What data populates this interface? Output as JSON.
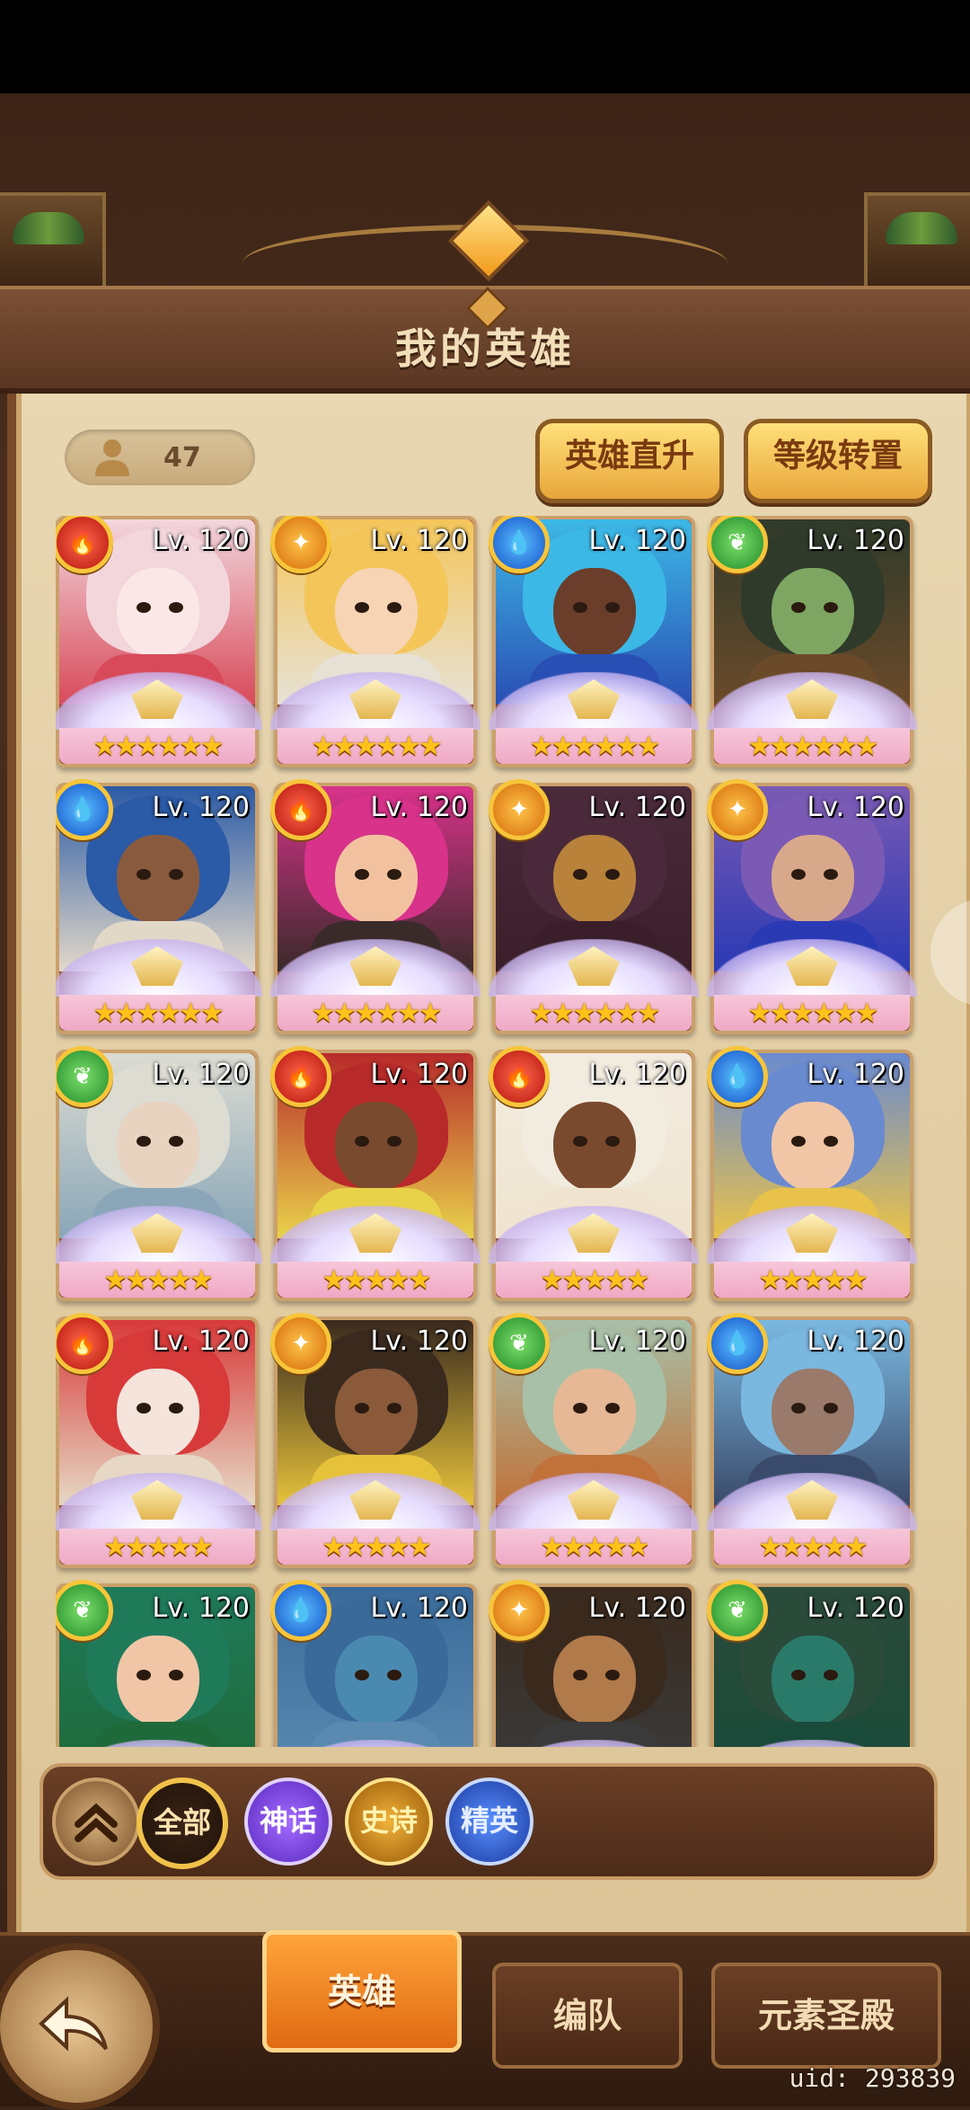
{
  "header": {
    "title": "我的英雄"
  },
  "hero_count": "47",
  "top_buttons": {
    "direct_upgrade": "英雄直升",
    "level_transfer": "等级转置"
  },
  "heroes": [
    {
      "level": "Lv. 120",
      "element": "fire",
      "stars": "★★★★★★",
      "colors": [
        "#f2d6dc",
        "#fbe8e6",
        "#d84a5a"
      ]
    },
    {
      "level": "Lv. 120",
      "element": "light",
      "stars": "★★★★★★",
      "colors": [
        "#f4c65a",
        "#f6d4b4",
        "#e7e1d5"
      ]
    },
    {
      "level": "Lv. 120",
      "element": "water",
      "stars": "★★★★★★",
      "colors": [
        "#3cb8e6",
        "#6b3e2c",
        "#2a4fb4"
      ]
    },
    {
      "level": "Lv. 120",
      "element": "nature",
      "stars": "★★★★★★",
      "colors": [
        "#2f3a2a",
        "#7ea662",
        "#6b4a2a"
      ]
    },
    {
      "level": "Lv. 120",
      "element": "water",
      "stars": "★★★★★★",
      "colors": [
        "#2b5aa6",
        "#8a5a3e",
        "#e2d8c8"
      ]
    },
    {
      "level": "Lv. 120",
      "element": "fire",
      "stars": "★★★★★★",
      "colors": [
        "#d8328a",
        "#f2c2a0",
        "#3a2a2a"
      ]
    },
    {
      "level": "Lv. 120",
      "element": "light",
      "stars": "★★★★★★",
      "colors": [
        "#4a2a3a",
        "#b8823a",
        "#3a1f2a"
      ]
    },
    {
      "level": "Lv. 120",
      "element": "light",
      "stars": "★★★★★★",
      "colors": [
        "#7a5ab4",
        "#d8a88a",
        "#2a3ab4"
      ]
    },
    {
      "level": "Lv. 120",
      "element": "nature",
      "stars": "★★★★★",
      "colors": [
        "#dcdcd2",
        "#e8d2c0",
        "#8aa6b8"
      ]
    },
    {
      "level": "Lv. 120",
      "element": "fire",
      "stars": "★★★★★",
      "colors": [
        "#b82a2a",
        "#7a4a2e",
        "#e8d24a"
      ]
    },
    {
      "level": "Lv. 120",
      "element": "fire",
      "stars": "★★★★★",
      "colors": [
        "#f2ece0",
        "#7a4a2e",
        "#f0e4d0"
      ]
    },
    {
      "level": "Lv. 120",
      "element": "water",
      "stars": "★★★★★",
      "colors": [
        "#6a8ad0",
        "#f0c6a6",
        "#e8c24a"
      ]
    },
    {
      "level": "Lv. 120",
      "element": "fire",
      "stars": "★★★★★",
      "colors": [
        "#d83a3a",
        "#f4e4dc",
        "#e6d8c4"
      ]
    },
    {
      "level": "Lv. 120",
      "element": "light",
      "stars": "★★★★★",
      "colors": [
        "#3a2a1e",
        "#8a5a3a",
        "#e6c23a"
      ]
    },
    {
      "level": "Lv. 120",
      "element": "nature",
      "stars": "★★★★★",
      "colors": [
        "#a8c0a8",
        "#e6b896",
        "#c0723a"
      ]
    },
    {
      "level": "Lv. 120",
      "element": "water",
      "stars": "★★★★★",
      "colors": [
        "#7ab8e0",
        "#9a7a6a",
        "#3a4a6a"
      ]
    },
    {
      "level": "Lv. 120",
      "element": "nature",
      "stars": "",
      "colors": [
        "#1f7a5a",
        "#f0c6a6",
        "#1f6a3a"
      ]
    },
    {
      "level": "Lv. 120",
      "element": "water",
      "stars": "",
      "colors": [
        "#3a6a9a",
        "#4a8ab0",
        "#5a8ab0"
      ]
    },
    {
      "level": "Lv. 120",
      "element": "light",
      "stars": "",
      "colors": [
        "#3a2a1e",
        "#b07a4a",
        "#3a3a3a"
      ]
    },
    {
      "level": "Lv. 120",
      "element": "nature",
      "stars": "",
      "colors": [
        "#2a4a3a",
        "#2a7a6a",
        "#1a4a3a"
      ]
    }
  ],
  "filters": {
    "all": "全部",
    "myth": "神话",
    "epic": "史诗",
    "elite": "精英"
  },
  "tabs": {
    "heroes": "英雄",
    "team": "编队",
    "temple": "元素圣殿"
  },
  "uid": "uid: 293839"
}
